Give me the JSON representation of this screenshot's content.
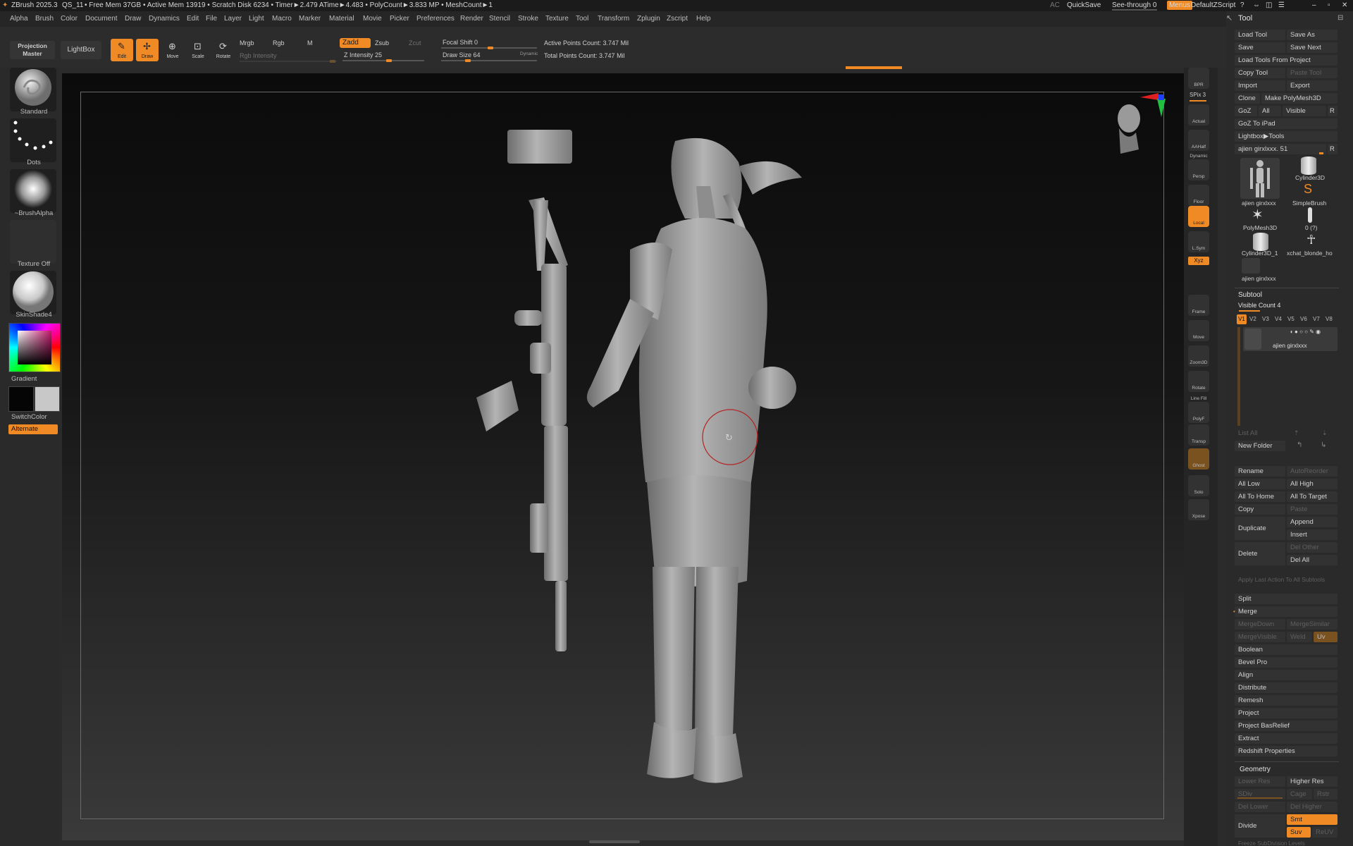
{
  "title_bar": {
    "app": "ZBrush 2025.3",
    "doc": "QS_11",
    "stats": "• Free Mem 37GB • Active Mem 13919 • Scratch Disk 6234 • Timer►2.479 ATime►4.483 • PolyCount►3.833 MP • MeshCount►1",
    "ac": "AC",
    "quicksave": "QuickSave",
    "see_through": "See-through 0",
    "menus": "Menus",
    "script": "DefaultZScript",
    "window_controls": [
      "?",
      "⇔",
      "◫",
      "☰",
      "–",
      "▫",
      "✕"
    ]
  },
  "menu": [
    "Alpha",
    "Brush",
    "Color",
    "Document",
    "Draw",
    "Dynamics",
    "Edit",
    "File",
    "Layer",
    "Light",
    "Macro",
    "Marker",
    "Material",
    "Movie",
    "Picker",
    "Preferences",
    "Render",
    "Stencil",
    "Stroke",
    "Texture",
    "Tool",
    "Transform",
    "Zplugin",
    "Zscript",
    "Help"
  ],
  "toolbar": {
    "projection_master": "Projection Master",
    "lightbox": "LightBox",
    "edit": "Edit",
    "draw": "Draw",
    "move": "Move",
    "scale": "Scale",
    "rotate": "Rotate",
    "mrgb": "Mrgb",
    "rgb": "Rgb",
    "m": "M",
    "rgb_intensity": "Rgb Intensity",
    "zadd": "Zadd",
    "zsub": "Zsub",
    "zcut": "Zcut",
    "z_intensity": "Z Intensity 25",
    "focal_shift": "Focal Shift 0",
    "draw_size": "Draw Size 64",
    "dynamic": "Dynamic",
    "active_points": "Active Points Count: 3.747 Mil",
    "total_points": "Total Points Count: 3.747 Mil"
  },
  "left_shelf": {
    "brush": "Standard",
    "stroke": "Dots",
    "alpha": "~BrushAlpha",
    "texture": "Texture Off",
    "material": "SkinShade4",
    "gradient": "Gradient",
    "switch_color": "SwitchColor",
    "alternate": "Alternate"
  },
  "right_shelf": [
    "BPR",
    "SPix 3",
    "Actual",
    "AAHalf",
    "Dynamic",
    "Persp",
    "Floor",
    "Local",
    "L.Sym",
    "Xyz",
    "Frame",
    "Move",
    "Zoom3D",
    "Rotate",
    "Line Fill",
    "PolyF",
    "Transp",
    "Ghost",
    "Solo",
    "Xpose"
  ],
  "tool_panel": {
    "header": "Tool",
    "load_tool": "Load Tool",
    "save_as": "Save As",
    "save": "Save",
    "save_next": "Save Next",
    "load_from_project": "Load Tools From Project",
    "copy_tool": "Copy Tool",
    "paste_tool": "Paste Tool",
    "import": "Import",
    "export": "Export",
    "clone": "Clone",
    "make_polymesh": "Make PolyMesh3D",
    "goz": "GoZ",
    "all": "All",
    "visible": "Visible",
    "r": "R",
    "goz_ipad": "GoZ To iPad",
    "lightbox_tools": "Lightbox▶Tools",
    "current_tool": "ajien girxlxxx. 51",
    "tools": [
      "ajien girxlxxx",
      "Cylinder3D",
      "SimpleBrush",
      "PolyMesh3D",
      "0 (?)",
      "Cylinder3D_1",
      "xchat_blonde_ho",
      "ajien girxlxxx"
    ],
    "subtool_header": "Subtool",
    "visible_count": "Visible Count 4",
    "versions": [
      "V1",
      "V2",
      "V3",
      "V4",
      "V5",
      "V6",
      "V7",
      "V8"
    ],
    "subtool_name": "ajien girxlxxx",
    "list_all": "List All",
    "new_folder": "New Folder",
    "rename": "Rename",
    "autoreorder": "AutoReorder",
    "all_low": "All Low",
    "all_high": "All High",
    "all_to_home": "All To Home",
    "all_to_target": "All To Target",
    "copy": "Copy",
    "paste": "Paste",
    "duplicate": "Duplicate",
    "append": "Append",
    "insert": "Insert",
    "delete": "Delete",
    "del_other": "Del Other",
    "del_all": "Del All",
    "apply_last": "Apply Last Action To All Subtools",
    "split": "Split",
    "merge": "Merge",
    "merge_down": "MergeDown",
    "merge_similar": "MergeSimilar",
    "merge_visible": "MergeVisible",
    "weld": "Weld",
    "uv": "Uv",
    "boolean": "Boolean",
    "bevel_pro": "Bevel Pro",
    "align": "Align",
    "distribute": "Distribute",
    "remesh": "Remesh",
    "project": "Project",
    "project_basrelief": "Project BasRelief",
    "extract": "Extract",
    "redshift": "Redshift Properties",
    "geometry_header": "Geometry",
    "lower_res": "Lower Res",
    "higher_res": "Higher Res",
    "sdiv": "SDiv",
    "cage": "Cage",
    "rstr": "Rstr",
    "del_lower": "Del Lower",
    "del_higher": "Del Higher",
    "divide": "Divide",
    "smt": "Smt",
    "suv": "Suv",
    "reuv": "ReUV",
    "freeze": "Freeze SubDivision Levels"
  }
}
